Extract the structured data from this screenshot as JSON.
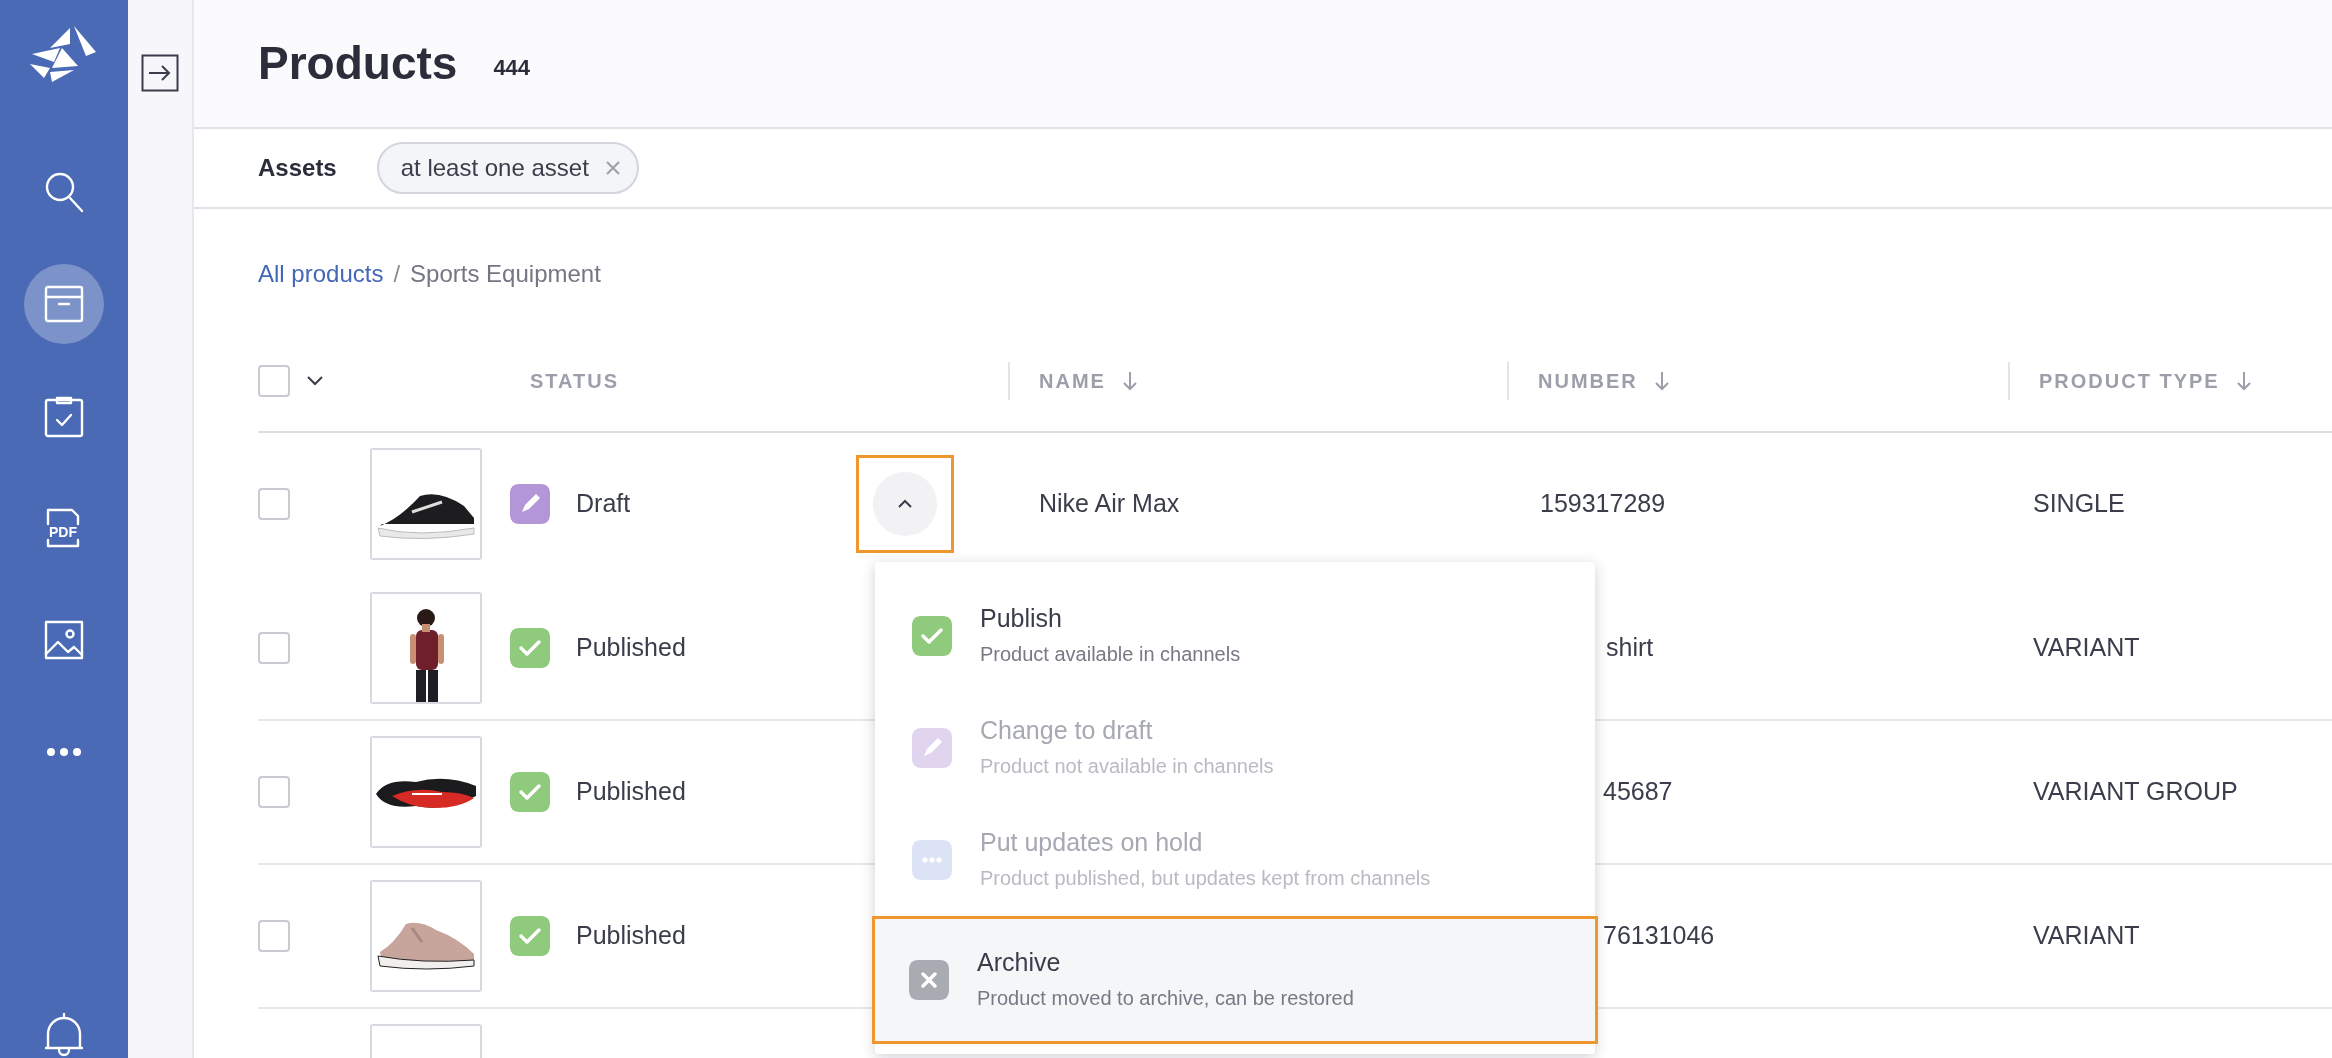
{
  "sidebar": {
    "items": [
      {
        "kind": "logo"
      },
      {
        "kind": "search",
        "selected": false
      },
      {
        "kind": "products",
        "selected": true
      },
      {
        "kind": "tasks",
        "selected": false
      },
      {
        "kind": "pdf",
        "label": "PDF",
        "selected": false
      },
      {
        "kind": "media",
        "selected": false
      },
      {
        "kind": "more",
        "selected": false
      },
      {
        "kind": "notifications",
        "selected": false
      }
    ]
  },
  "header": {
    "title": "Products",
    "count": "444"
  },
  "filters": [
    {
      "label": "Assets",
      "chips": [
        {
          "text": "at least one asset"
        }
      ]
    }
  ],
  "breadcrumb": {
    "separator": "/",
    "items": [
      {
        "text": "All products",
        "link": true
      },
      {
        "text": "Sports Equipment",
        "link": false
      }
    ]
  },
  "table": {
    "select_all": {
      "checked": false
    },
    "columns": [
      {
        "label": "STATUS",
        "sortable": false
      },
      {
        "label": "NAME",
        "sortable": true
      },
      {
        "label": "NUMBER",
        "sortable": true
      },
      {
        "label": "PRODUCT TYPE",
        "sortable": true
      }
    ],
    "rows": [
      {
        "checked": false,
        "image": {
          "kind": "picture"
        },
        "status": {
          "kind": "draft",
          "label": "Draft"
        },
        "menu_button": {
          "expanded": true
        },
        "name": {
          "text": "Nike Air Max",
          "covered": false
        },
        "number": {
          "text": "159317289",
          "covered": false
        },
        "product_type": {
          "text": "SINGLE"
        }
      },
      {
        "checked": false,
        "image": {
          "kind": "picture"
        },
        "status": {
          "kind": "published",
          "label": "Published"
        },
        "name": {
          "text": "shirt",
          "covered": true
        },
        "product_type": {
          "text": "VARIANT"
        }
      },
      {
        "checked": false,
        "image": {
          "kind": "picture"
        },
        "status": {
          "kind": "published",
          "label": "Published"
        },
        "number": {
          "text": "45687",
          "covered": true
        },
        "product_type": {
          "text": "VARIANT GROUP"
        }
      },
      {
        "checked": false,
        "image": {
          "kind": "picture"
        },
        "status": {
          "kind": "published",
          "label": "Published"
        },
        "number": {
          "text": "76131046",
          "covered": true
        },
        "product_type": {
          "text": "VARIANT"
        }
      },
      {
        "image": {
          "kind": "picture"
        }
      }
    ]
  },
  "status_menu": {
    "items": [
      {
        "kind": "publish",
        "title": "Publish",
        "description": "Product available in channels",
        "disabled": false,
        "selected": false
      },
      {
        "kind": "draft",
        "title": "Change to draft",
        "description": "Product not available in channels",
        "disabled": true,
        "selected": false
      },
      {
        "kind": "hold",
        "title": "Put updates on hold",
        "description": "Product published, but updates kept from channels",
        "disabled": true,
        "selected": false
      },
      {
        "kind": "archive",
        "title": "Archive",
        "description": "Product moved to archive, can be restored",
        "disabled": false,
        "selected": true
      }
    ]
  }
}
